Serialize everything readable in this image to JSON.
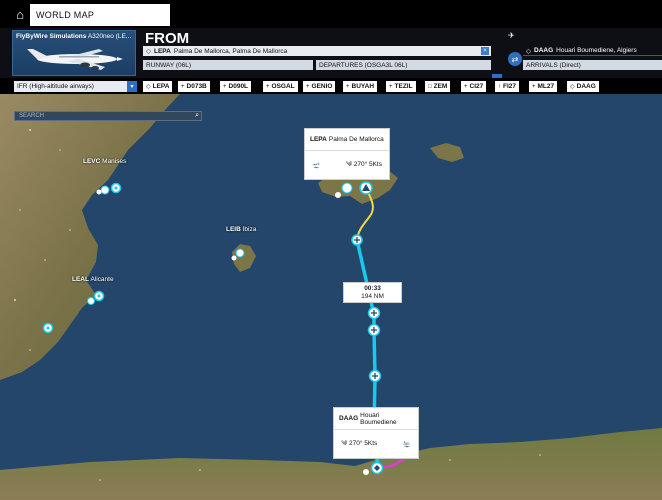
{
  "topbar": {
    "home_icon": "home-icon",
    "tab_label": "WORLD MAP"
  },
  "aircraft": {
    "brand": "FlyByWire Simulations",
    "model": "A320neo (LE..."
  },
  "from_label": "FROM",
  "departure": {
    "icao": "LEPA",
    "name": "Palma De Mallorca, Palma De Mallorca",
    "runway": "RUNWAY (06L)",
    "procedure": "DEPARTURES (OSGA3L 06L)"
  },
  "arrival": {
    "icao": "DAAG",
    "name": "Houari Boumediene, Algiers",
    "procedure": "ARRIVALS (Direct)"
  },
  "route": {
    "mode": "IFR (High-altitude airways)",
    "waypoints": [
      {
        "glyph": "◇",
        "name": "LEPA"
      },
      {
        "glyph": "+",
        "name": "D073B"
      },
      {
        "glyph": "+",
        "name": "D090L"
      },
      {
        "glyph": "+",
        "name": "OSGAL"
      },
      {
        "glyph": "+",
        "name": "GENIO"
      },
      {
        "glyph": "+",
        "name": "BUYAH"
      },
      {
        "glyph": "+",
        "name": "TEZIL"
      },
      {
        "glyph": "□",
        "name": "ZEM"
      },
      {
        "glyph": "+",
        "name": "CI27"
      },
      {
        "glyph": "↑",
        "name": "FI27"
      },
      {
        "glyph": "+",
        "name": "ML27"
      },
      {
        "glyph": "◇",
        "name": "DAAG"
      }
    ]
  },
  "search": {
    "placeholder": "SEARCH"
  },
  "map": {
    "airports": [
      {
        "icao": "LEVC",
        "name": "Manises"
      },
      {
        "icao": "LEIB",
        "name": "Ibiza"
      },
      {
        "icao": "LEAL",
        "name": "Alicante"
      }
    ],
    "dep_card": {
      "icao": "LEPA",
      "name": "Palma De Mallorca",
      "wind": "270° 5Kts"
    },
    "arr_card": {
      "icao": "DAAG",
      "name": "Houari Boumediene",
      "wind": "270° 5Kts"
    },
    "leg": {
      "time": "00:33",
      "distance": "194 NM"
    }
  },
  "colors": {
    "route": "#18c9ee",
    "departure_path": "#f2d74a",
    "arrival_path": "#e23bd4",
    "sea": "#24466a",
    "panel": "#0d0f14"
  }
}
